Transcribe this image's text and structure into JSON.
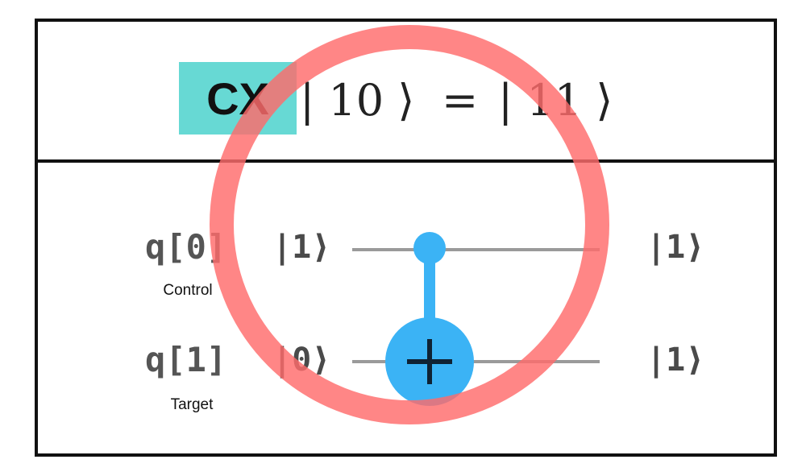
{
  "equation": {
    "gate": "CX",
    "input_state": "| 10 ⟩",
    "equals": "=",
    "output_state": "| 11 ⟩"
  },
  "circuit": {
    "qubits": [
      {
        "label": "q[0]",
        "role": "Control",
        "input": "|1⟩",
        "output": "|1⟩"
      },
      {
        "label": "q[1]",
        "role": "Target",
        "input": "|0⟩",
        "output": "|1⟩"
      }
    ],
    "gate_symbol": "+"
  },
  "colors": {
    "gate_badge": "#67d9d4",
    "gate_blue": "#3bb3f5",
    "wire": "#9a9a9a",
    "overlay_circle": "#ff6b6b",
    "frame": "#111111"
  },
  "icons": {
    "control_dot": "filled-circle",
    "target": "circle-plus",
    "overlay": "red-ring"
  }
}
